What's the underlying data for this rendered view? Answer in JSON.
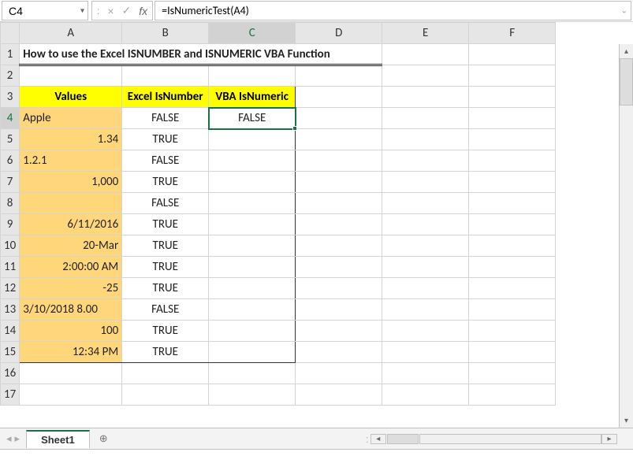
{
  "namebox": "C4",
  "formula": "=IsNumericTest(A4)",
  "columns": [
    "A",
    "B",
    "C",
    "D",
    "E",
    "F"
  ],
  "row_numbers": [
    1,
    2,
    3,
    4,
    5,
    6,
    7,
    8,
    9,
    10,
    11,
    12,
    13,
    14,
    15,
    16,
    17
  ],
  "title": "How to use the Excel ISNUMBER and ISNUMERIC VBA Function",
  "headers": {
    "A": "Values",
    "B": "Excel IsNumber",
    "C": "VBA IsNumeric"
  },
  "rows": [
    {
      "A": "Apple",
      "A_align": "left",
      "B": "FALSE",
      "C": "FALSE"
    },
    {
      "A": "1.34",
      "A_align": "right",
      "B": "TRUE",
      "C": ""
    },
    {
      "A": "1.2.1",
      "A_align": "left",
      "B": "FALSE",
      "C": ""
    },
    {
      "A": "1,000",
      "A_align": "right",
      "B": "TRUE",
      "C": ""
    },
    {
      "A": "",
      "A_align": "right",
      "B": "FALSE",
      "C": ""
    },
    {
      "A": "6/11/2016",
      "A_align": "right",
      "B": "TRUE",
      "C": ""
    },
    {
      "A": "20-Mar",
      "A_align": "right",
      "B": "TRUE",
      "C": ""
    },
    {
      "A": "2:00:00 AM",
      "A_align": "right",
      "B": "TRUE",
      "C": ""
    },
    {
      "A": "-25",
      "A_align": "right",
      "B": "TRUE",
      "C": ""
    },
    {
      "A": "3/10/2018 8.00",
      "A_align": "left",
      "B": "FALSE",
      "C": ""
    },
    {
      "A": "100",
      "A_align": "right",
      "B": "TRUE",
      "C": ""
    },
    {
      "A": "12:34 PM",
      "A_align": "right",
      "B": "TRUE",
      "C": ""
    }
  ],
  "sheet_tab": "Sheet1",
  "glyphs": {
    "chevron_down": "▾",
    "x": "×",
    "check": "✓",
    "fx": "fx",
    "colon": ":",
    "plus_circle": "⊕",
    "tri_left": "◂",
    "tri_right": "▸",
    "tri_up": "▴",
    "tri_down": "▾",
    "expand": "⌄"
  }
}
